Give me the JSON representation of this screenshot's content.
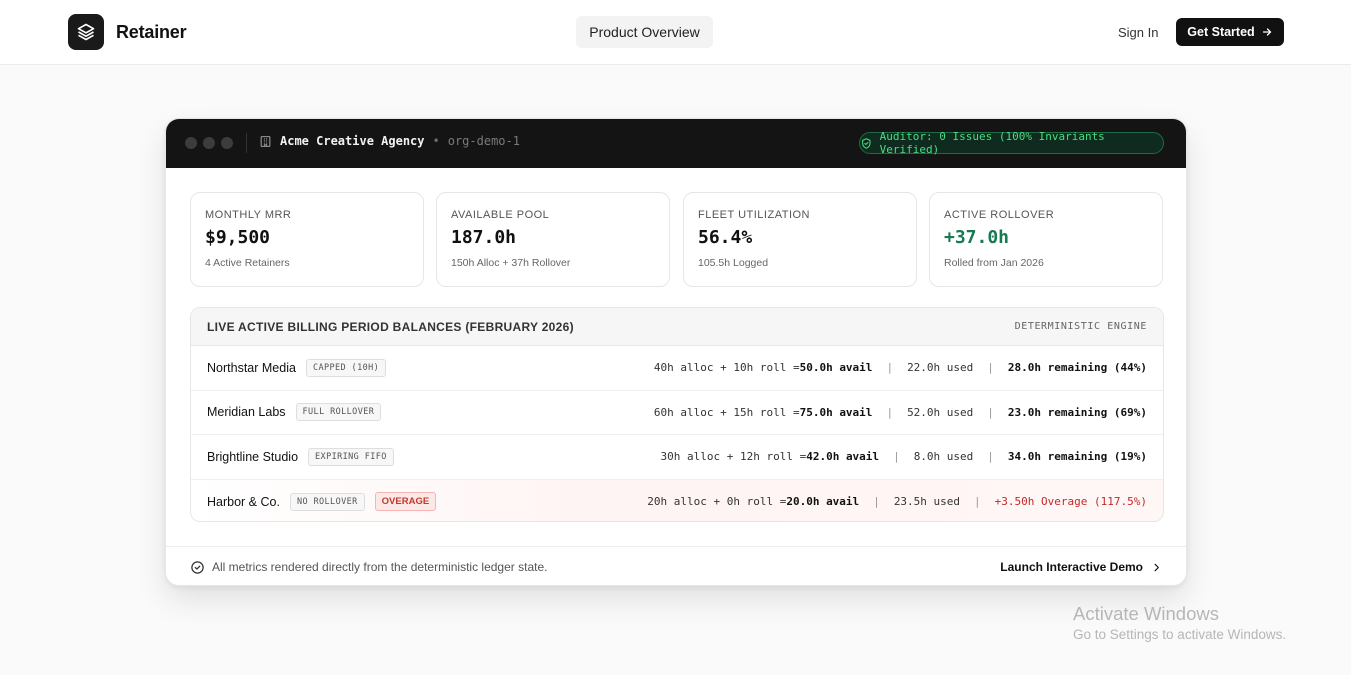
{
  "header": {
    "brand": "Retainer",
    "brand_icon": "layers-icon",
    "nav_center": "Product Overview",
    "sign_in": "Sign In",
    "get_started": "Get Started"
  },
  "dashboard": {
    "org_name": "Acme Creative Agency",
    "org_separator": "•",
    "org_id": "org-demo-1",
    "auditor_status": "Auditor: 0 Issues (100% Invariants Verified)",
    "stats": [
      {
        "label": "MONTHLY MRR",
        "value": "$9,500",
        "sub": "4 Active Retainers"
      },
      {
        "label": "AVAILABLE POOL",
        "value": "187.0h",
        "sub": "150h Alloc + 37h Rollover"
      },
      {
        "label": "FLEET UTILIZATION",
        "value": "56.4%",
        "sub": "105.5h Logged"
      },
      {
        "label": "ACTIVE ROLLOVER",
        "value": "+37.0h",
        "sub": "Rolled from Jan 2026"
      }
    ],
    "balances": {
      "title": "LIVE ACTIVE BILLING PERIOD BALANCES (FEBRUARY 2026)",
      "engine": "DETERMINISTIC ENGINE",
      "separator": "|",
      "rows": [
        {
          "client": "Northstar Media",
          "tag": "CAPPED (10H)",
          "formula": "40h alloc + 10h roll = ",
          "avail": "50.0h avail",
          "used": "22.0h used",
          "remaining": "28.0h remaining (44%)"
        },
        {
          "client": "Meridian Labs",
          "tag": "FULL ROLLOVER",
          "formula": "60h alloc + 15h roll = ",
          "avail": "75.0h avail",
          "used": "52.0h used",
          "remaining": "23.0h remaining (69%)"
        },
        {
          "client": "Brightline Studio",
          "tag": "EXPIRING FIFO",
          "formula": "30h alloc + 12h roll = ",
          "avail": "42.0h avail",
          "used": "8.0h used",
          "remaining": "34.0h remaining (19%)"
        },
        {
          "client": "Harbor & Co.",
          "tag": "NO ROLLOVER",
          "badge": "OVERAGE",
          "formula": "20h alloc + 0h roll = ",
          "avail": "20.0h avail",
          "used": "23.5h used",
          "remaining": "+3.50h Overage (117.5%)"
        }
      ]
    },
    "footer_note": "All metrics rendered directly from the deterministic ledger state.",
    "launch_demo": "Launch Interactive Demo"
  },
  "watermark": {
    "line1": "Activate Windows",
    "line2": "Go to Settings to activate Windows."
  },
  "colors": {
    "accent_dark": "#111111",
    "success_green": "#4ade80",
    "rollover_green": "#177a52",
    "overage_red": "#c62828"
  }
}
